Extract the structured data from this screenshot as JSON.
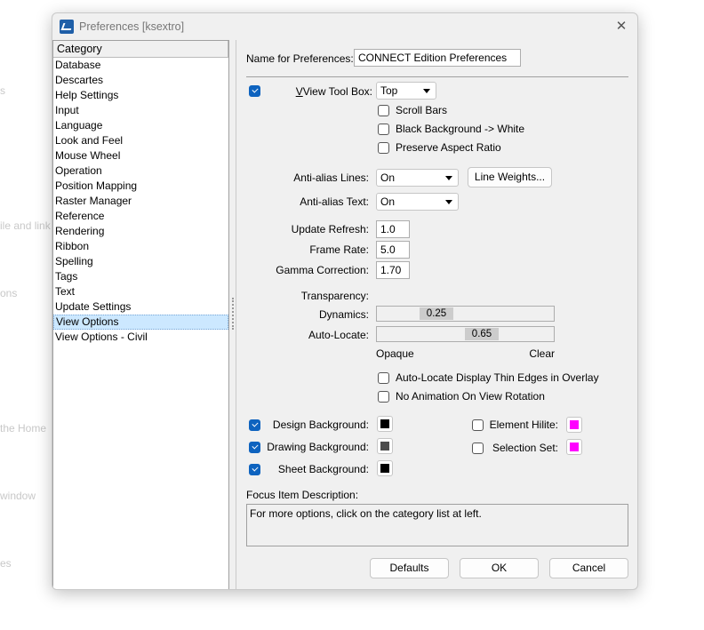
{
  "background_fragments": [
    "s",
    "ile and link",
    "ons",
    "the Home",
    "window",
    "es"
  ],
  "window": {
    "title": "Preferences [ksextro]"
  },
  "category": {
    "header": "Category",
    "items": [
      "Database",
      "Descartes",
      "Help Settings",
      "Input",
      "Language",
      "Look and Feel",
      "Mouse Wheel",
      "Operation",
      "Position Mapping",
      "Raster Manager",
      "Reference",
      "Rendering",
      "Ribbon",
      "Spelling",
      "Tags",
      "Text",
      "Update Settings",
      "View Options",
      "View Options - Civil"
    ],
    "selected": "View Options"
  },
  "name_label": "Name for Preferences:",
  "name_value": "CONNECT Edition Preferences",
  "view_tool_box": {
    "label": "View Tool Box:",
    "value": "Top",
    "checked": true
  },
  "options": [
    {
      "label": "Scroll Bars",
      "checked": false
    },
    {
      "label": "Black Background -> White",
      "checked": false
    },
    {
      "label": "Preserve Aspect Ratio",
      "checked": false
    }
  ],
  "aa_lines": {
    "label": "Anti-alias Lines:",
    "value": "On"
  },
  "line_weights": "Line Weights...",
  "aa_text": {
    "label": "Anti-alias Text:",
    "value": "On"
  },
  "update_refresh": {
    "label": "Update Refresh:",
    "value": "1.0"
  },
  "frame_rate": {
    "label": "Frame Rate:",
    "value": "5.0"
  },
  "gamma": {
    "label": "Gamma Correction:",
    "value": "1.70"
  },
  "transparency": {
    "label": "Transparency:",
    "dynamics_label": "Dynamics:",
    "dynamics": "0.25",
    "autolocate_label": "Auto-Locate:",
    "autolocate": "0.65",
    "min": "Opaque",
    "max": "Clear"
  },
  "options2": [
    {
      "label": "Auto-Locate Display Thin Edges in Overlay",
      "checked": false
    },
    {
      "label": "No Animation On View Rotation",
      "checked": false
    }
  ],
  "colors": [
    {
      "label": "Design Background:",
      "checked": true,
      "color": "#000000"
    },
    {
      "label": "Drawing Background:",
      "checked": true,
      "color": "#4d4d4d"
    },
    {
      "label": "Sheet Background:",
      "checked": true,
      "color": "#000000"
    },
    {
      "label": "Element Hilite:",
      "checked": false,
      "color": "#ff00ff"
    },
    {
      "label": "Selection Set:",
      "checked": false,
      "color": "#ff00ff"
    }
  ],
  "focus": {
    "label": "Focus Item Description:",
    "text": "For more options, click on the category list at left."
  },
  "buttons": {
    "defaults": "Defaults",
    "ok": "OK",
    "cancel": "Cancel"
  }
}
